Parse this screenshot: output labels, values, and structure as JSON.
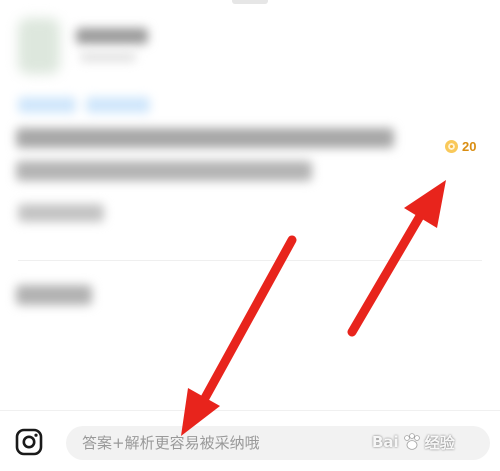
{
  "question": {
    "reward_points": "20"
  },
  "answer_bar": {
    "placeholder": "答案+解析更容易被采纳哦",
    "camera_icon": "camera-icon"
  },
  "watermark": {
    "text": "Bai",
    "suffix": "经验"
  },
  "colors": {
    "coin": "#f6b73c",
    "reward_text": "#d98d12",
    "arrow": "#e8241c",
    "input_bg": "#f2f2f2"
  }
}
